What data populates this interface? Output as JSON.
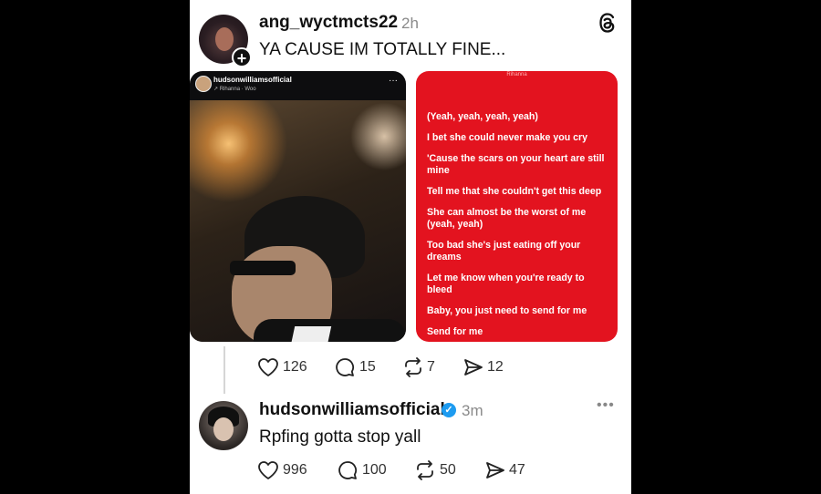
{
  "post": {
    "username": "ang_wyctmcts22",
    "time": "2h",
    "text": "YA CAUSE IM TOTALLY FINE...",
    "screenshot": {
      "username": "hudsonwilliamsofficial",
      "song": "↗ Rihanna · Woo",
      "more": "···"
    },
    "lyrics_card": {
      "artist": "Rihanna",
      "lines": [
        "(Yeah, yeah, yeah, yeah)",
        "I bet she could never make you cry",
        "'Cause the scars on your heart are still mine",
        "Tell me that she couldn't get this deep",
        "She can almost be the worst of me (yeah, yeah)",
        "Too bad she's just eating off your dreams",
        "Let me know when you're ready to bleed",
        "Baby, you just need to send for me",
        "Send for me"
      ]
    },
    "stats": {
      "likes": "126",
      "replies": "15",
      "reposts": "7",
      "shares": "12"
    }
  },
  "reply": {
    "username": "hudsonwilliamsofficial",
    "time": "3m",
    "text": "Rpfing gotta stop yall",
    "stats": {
      "likes": "996",
      "replies": "100",
      "reposts": "50",
      "shares": "47"
    }
  },
  "icons": {
    "threads": "threads-logo-icon",
    "like": "heart-icon",
    "reply": "comment-icon",
    "repost": "repost-icon",
    "share": "send-icon",
    "verified": "verified-badge-icon"
  }
}
